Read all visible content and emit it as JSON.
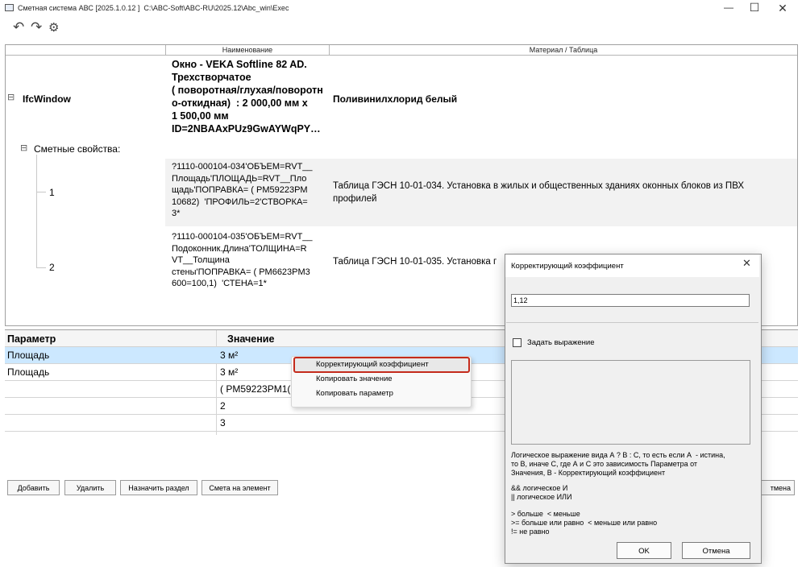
{
  "window": {
    "title": "Сметная система АВС [2025.1.0.12 ]  C:\\ABC-Soft\\ABC-RU\\2025.12\\Abc_win\\Exec",
    "minimize_glyph": "—",
    "maximize_glyph": "☐",
    "close_glyph": "✕",
    "undo_glyph": "↶",
    "redo_glyph": "↷",
    "settings_glyph": "⚙"
  },
  "tree": {
    "columns": [
      "Наименование",
      "Материал / Таблица"
    ],
    "root": {
      "label": "IfcWindow",
      "expander": "⊟",
      "name": "Окно - VEKA Softline 82 AD. Трехстворчатое (поворотная/глухая/поворотно-откидная) : 2 000,00 мм x 1 500,00 мм ID=2NBAAxPUz9GwAYWqPY…",
      "name_lines": [
        "Окно - VEKA Softline 82 AD.",
        "Трехстворчатое",
        "( поворотная/глухая/поворотн",
        "о-откидная)  : 2 000,00 мм x",
        "1 500,00 мм",
        "ID=2NBAAxPUz9GwAYWqPY…"
      ],
      "material": "Поливинилхлорид белый"
    },
    "group": {
      "label": "Сметные свойства:",
      "expander": "⊟"
    },
    "children": [
      {
        "num": "1",
        "name_lines": [
          "?1110-000104-034'ОБЪЕМ=RVT__",
          "Площадь'ПЛОЩАДЬ=RVT__Пло",
          "щадь'ПОПРАВКА= ( PM59223PM",
          "10682)  'ПРОФИЛЬ=2'СТВОРКА=",
          "3*"
        ],
        "table_lines": [
          "Таблица ГЭСН 10-01-034. Установка в жилых и общественных зданиях оконных блоков из ПВХ",
          "профилей"
        ]
      },
      {
        "num": "2",
        "name_lines": [
          "?1110-000104-035'ОБЪЕМ=RVT__",
          "Подоконник.Длина'ТОЛЩИНА=R",
          "VT__Толщина",
          "стены'ПОПРАВКА= ( PM6623PM3",
          "600=100,1)  'СТЕНА=1*"
        ],
        "table_lines": [
          "Таблица ГЭСН 10-01-035. Установка г"
        ]
      }
    ]
  },
  "params": {
    "headers": [
      "Параметр",
      "Значение"
    ],
    "rows": [
      {
        "param": "Площадь",
        "value": "3 м²"
      },
      {
        "param": "Площадь",
        "value": "3 м²"
      },
      {
        "param": "",
        "value": "( PM59223PM1("
      },
      {
        "param": "",
        "value": "2"
      },
      {
        "param": "",
        "value": "3"
      }
    ]
  },
  "buttons": {
    "add": "Добавить",
    "delete": "Удалить",
    "assign": "Назначить раздел",
    "estimate": "Смета на элемент",
    "cancel_partial": "тмена"
  },
  "context_menu": {
    "items": [
      "Корректирующий коэффициент",
      "Копировать значение",
      "Копировать параметр"
    ]
  },
  "dialog": {
    "title": "Корректирующий коэффициент",
    "close_glyph": "✕",
    "value": "1,12",
    "checkbox_label": "Задать выражение",
    "checkbox_checked": false,
    "help_lines": [
      "Логическое выражение вида А ? В : С, то есть если А  - истина,",
      "то В, иначе С, где А и С это зависимость Параметра от",
      "Значения, В - Корректирующий коэффициент"
    ],
    "ops1": [
      "&& логическое И",
      "|| логическое ИЛИ"
    ],
    "ops2": [
      "> больше  < меньше",
      ">= больше или равно  < меньше или равно",
      "!= не равно"
    ],
    "ok": "OK",
    "cancel": "Отмена"
  },
  "colors": {
    "selection": "#cce8ff",
    "tree_sub_bg": "#f2f2f2",
    "menu_highlight_border": "#c42b1c"
  }
}
